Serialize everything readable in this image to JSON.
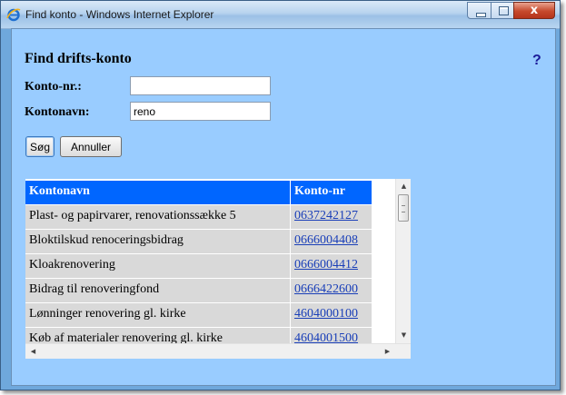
{
  "window": {
    "title": "Find konto - Windows Internet Explorer",
    "close_glyph": "x"
  },
  "page": {
    "heading": "Find drifts-konto",
    "help": "?"
  },
  "form": {
    "konto_nr_label": "Konto-nr.:",
    "konto_nr_value": "",
    "kontonavn_label": "Kontonavn:",
    "kontonavn_value": "reno",
    "search_button": "Søg",
    "cancel_button": "Annuller"
  },
  "table": {
    "columns": [
      "Kontonavn",
      "Konto-nr"
    ],
    "rows": [
      {
        "name": "Plast- og papirvarer, renovationssække 5",
        "number": "0637242127"
      },
      {
        "name": "Bloktilskud renoceringsbidrag",
        "number": "0666004408"
      },
      {
        "name": "Kloakrenovering",
        "number": "0666004412"
      },
      {
        "name": "Bidrag til renoveringfond",
        "number": "0666422600"
      },
      {
        "name": "Lønninger renovering gl. kirke",
        "number": "4604000100"
      },
      {
        "name": "Køb af materialer renovering gl. kirke",
        "number": "4604001500"
      }
    ]
  },
  "icons": {
    "browser": "ie-icon",
    "minimize": "minimize-icon",
    "maximize": "maximize-icon",
    "close": "close-icon"
  },
  "colors": {
    "content_bg": "#99ccff",
    "table_header": "#0066ff",
    "table_row": "#d9d9d9",
    "link": "#1a3fb8"
  }
}
